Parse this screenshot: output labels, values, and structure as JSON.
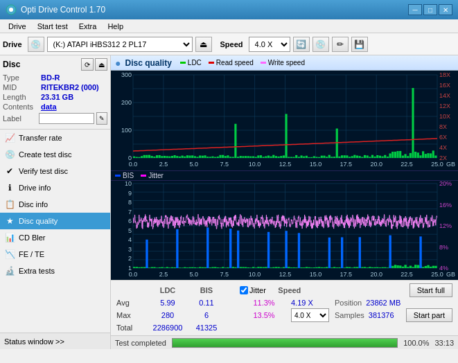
{
  "titleBar": {
    "title": "Opti Drive Control 1.70",
    "minimizeLabel": "─",
    "maximizeLabel": "□",
    "closeLabel": "✕"
  },
  "menuBar": {
    "items": [
      "Drive",
      "Start test",
      "Extra",
      "Help"
    ]
  },
  "driveToolbar": {
    "driveLabel": "Drive",
    "driveValue": "(K:)  ATAPI iHBS312  2 PL17",
    "speedLabel": "Speed",
    "speedValue": "4.0 X"
  },
  "discSection": {
    "title": "Disc",
    "typeLabel": "Type",
    "typeValue": "BD-R",
    "midLabel": "MID",
    "midValue": "RITEKBR2 (000)",
    "lengthLabel": "Length",
    "lengthValue": "23.31 GB",
    "contentsLabel": "Contents",
    "contentsValue": "data",
    "labelLabel": "Label",
    "labelValue": ""
  },
  "navItems": [
    {
      "id": "transfer-rate",
      "label": "Transfer rate",
      "icon": "📈"
    },
    {
      "id": "create-test-disc",
      "label": "Create test disc",
      "icon": "💿"
    },
    {
      "id": "verify-test-disc",
      "label": "Verify test disc",
      "icon": "✔"
    },
    {
      "id": "drive-info",
      "label": "Drive info",
      "icon": "ℹ"
    },
    {
      "id": "disc-info",
      "label": "Disc info",
      "icon": "📋"
    },
    {
      "id": "disc-quality",
      "label": "Disc quality",
      "icon": "★",
      "active": true
    },
    {
      "id": "cd-bler",
      "label": "CD Bler",
      "icon": "📊"
    },
    {
      "id": "fe-te",
      "label": "FE / TE",
      "icon": "📉"
    },
    {
      "id": "extra-tests",
      "label": "Extra tests",
      "icon": "🔬"
    }
  ],
  "statusWindow": {
    "label": "Status window >> "
  },
  "qualityHeader": {
    "title": "Disc quality",
    "legend": [
      {
        "id": "ldc",
        "label": "LDC",
        "color": "#00aa00"
      },
      {
        "id": "read-speed",
        "label": "Read speed",
        "color": "#cc0000"
      },
      {
        "id": "write-speed",
        "label": "Write speed",
        "color": "#ff66ff"
      }
    ],
    "legend2": [
      {
        "id": "bis",
        "label": "BIS",
        "color": "#0000dd"
      },
      {
        "id": "jitter",
        "label": "Jitter",
        "color": "#ff00ff"
      }
    ]
  },
  "chart1": {
    "yMax": 300,
    "yLabels": [
      "300",
      "200",
      "100",
      "0"
    ],
    "yRightLabels": [
      "18X",
      "16X",
      "14X",
      "12X",
      "10X",
      "8X",
      "6X",
      "4X",
      "2X"
    ],
    "xLabels": [
      "0.0",
      "2.5",
      "5.0",
      "7.5",
      "10.0",
      "12.5",
      "15.0",
      "17.5",
      "20.0",
      "22.5",
      "25.0"
    ]
  },
  "chart2": {
    "yMax": 10,
    "yLabels": [
      "10",
      "9",
      "8",
      "7",
      "6",
      "5",
      "4",
      "3",
      "2",
      "1"
    ],
    "yRightLabels": [
      "20%",
      "16%",
      "12%",
      "8%",
      "4%"
    ],
    "xLabels": [
      "0.0",
      "2.5",
      "5.0",
      "7.5",
      "10.0",
      "12.5",
      "15.0",
      "17.5",
      "20.0",
      "22.5",
      "25.0"
    ]
  },
  "stats": {
    "headers": [
      "",
      "LDC",
      "BIS",
      "",
      "Jitter",
      "Speed",
      ""
    ],
    "avgLabel": "Avg",
    "avgLDC": "5.99",
    "avgBIS": "0.11",
    "avgJitter": "11.3%",
    "maxLabel": "Max",
    "maxLDC": "280",
    "maxBIS": "6",
    "maxJitter": "13.5%",
    "totalLabel": "Total",
    "totalLDC": "2286900",
    "totalBIS": "41325",
    "jitterChecked": true,
    "jitterLabel": "Jitter",
    "speedAvg": "4.19 X",
    "speedLabel": "Speed",
    "positionLabel": "Position",
    "positionValue": "23862 MB",
    "samplesLabel": "Samples",
    "samplesValue": "381376",
    "speedSelectValue": "4.0 X",
    "startFullLabel": "Start full",
    "startPartLabel": "Start part"
  },
  "progressBar": {
    "percent": 100,
    "percentLabel": "100.0%",
    "timeLabel": "33:13"
  },
  "statusText": "Test completed"
}
